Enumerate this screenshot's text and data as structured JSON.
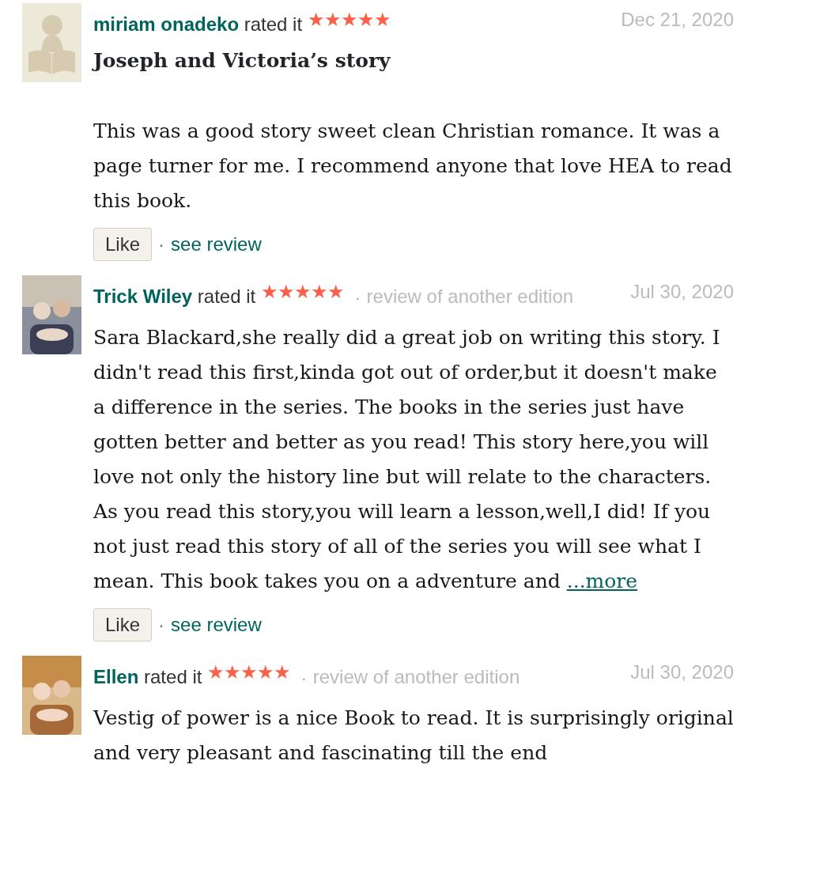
{
  "reviews": [
    {
      "avatar": {
        "kind": "placeholder"
      },
      "user": "miriam onadeko",
      "rated_text": "rated it",
      "stars": 5,
      "date": "Dec 21, 2020",
      "title": "Joseph and Victoria’s story",
      "body": "This was a good story sweet clean Christian romance. It was a page turner for me. I recommend anyone that love HEA to read this book.",
      "like": "Like",
      "separator": "·",
      "see_review": "see review"
    },
    {
      "user": "Trick Wiley",
      "rated_text": "rated it",
      "stars": 5,
      "edition_separator": "·",
      "edition_note": "review of another edition",
      "date": "Jul 30, 2020",
      "body": "Sara Blackard,she really did a great job on writing this story. I didn't read this first,kinda got out of order,but it doesn't make a difference in the series. The books in the series just have gotten better and better as you read! This story here,you will love not only the history line but will relate to the characters. As you read this story,you will learn a lesson,well,I did! If you not just read this story of all of the series you will see what I mean. This book takes you on a adventure and",
      "more": "...more",
      "like": "Like",
      "separator": "·",
      "see_review": "see review"
    },
    {
      "user": "Ellen",
      "rated_text": "rated it",
      "stars": 5,
      "edition_separator": "·",
      "edition_note": "review of another edition",
      "date": "Jul 30, 2020",
      "body": "Vestig of power is a nice Book to read. It is surprisingly original and very pleasant and fascinating till the end"
    }
  ]
}
